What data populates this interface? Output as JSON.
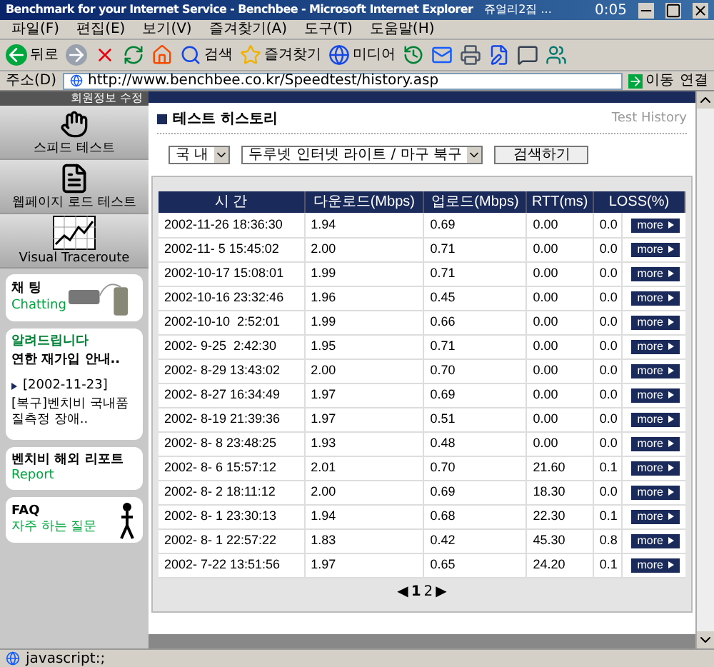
{
  "window": {
    "title": "Benchmark for your Internet Service - Benchbee - Microsoft Internet Explorer",
    "extra": "쥬얼리2집 ...",
    "clock": "0:05"
  },
  "menu": [
    "파일(F)",
    "편집(E)",
    "보기(V)",
    "즐겨찾기(A)",
    "도구(T)",
    "도움말(H)"
  ],
  "toolbar": [
    {
      "kind": "back",
      "label": "뒤로"
    },
    {
      "kind": "forward"
    },
    {
      "kind": "stop"
    },
    {
      "kind": "refresh"
    },
    {
      "kind": "home"
    },
    {
      "kind": "search",
      "label": "검색"
    },
    {
      "kind": "favorites",
      "label": "즐겨찾기"
    },
    {
      "kind": "media",
      "label": "미디어"
    },
    {
      "kind": "history"
    },
    {
      "kind": "mail"
    },
    {
      "kind": "print"
    },
    {
      "kind": "edit"
    },
    {
      "kind": "discuss"
    },
    {
      "kind": "messenger"
    }
  ],
  "address": {
    "label": "주소(D)",
    "value": "http://www.benchbee.co.kr/Speedtest/history.asp",
    "go": "이동",
    "links": "연결"
  },
  "sidebar": {
    "member": "회원정보 수정",
    "nav": [
      {
        "kind": "hand",
        "label": "스피드 테스트"
      },
      {
        "kind": "page",
        "label": "웹페이지 로드 테스트"
      },
      {
        "kind": "graph",
        "label": "Visual Traceroute"
      }
    ],
    "chat": {
      "title": "채 팅",
      "subtitle": "Chatting"
    },
    "notice": {
      "title": "알려드립니다",
      "headline": "연한 재가입 안내..",
      "date": "[2002-11-23]",
      "text": "[복구]벤치비 국내품질측정 장애.."
    },
    "report": {
      "title": "벤치비 해외 리포트",
      "subtitle": "Report"
    },
    "faq": {
      "title": "FAQ",
      "subtitle": "자주 하는 질문"
    }
  },
  "main": {
    "title": "테스트 히스토리",
    "subtitle": "Test History",
    "filters": [
      "국 내",
      "두루넷 인터넷 라이트 / 마구 북구"
    ],
    "search_button": "검색하기",
    "table": {
      "columns": [
        "시 간",
        "다운로드(Mbps)",
        "업로드(Mbps)",
        "RTT(ms)",
        "LOSS(%)"
      ],
      "rows": [
        {
          "cells": [
            "2002-11-26 18:36:30",
            "1.94",
            "0.69",
            "0.00",
            "0.0"
          ],
          "more": "more"
        },
        {
          "cells": [
            "2002-11- 5 15:45:02",
            "2.00",
            "0.71",
            "0.00",
            "0.0"
          ],
          "more": "more"
        },
        {
          "cells": [
            "2002-10-17 15:08:01",
            "1.99",
            "0.71",
            "0.00",
            "0.0"
          ],
          "more": "more"
        },
        {
          "cells": [
            "2002-10-16 23:32:46",
            "1.96",
            "0.45",
            "0.00",
            "0.0"
          ],
          "more": "more"
        },
        {
          "cells": [
            "2002-10-10  2:52:01",
            "1.99",
            "0.66",
            "0.00",
            "0.0"
          ],
          "more": "more"
        },
        {
          "cells": [
            "2002- 9-25  2:42:30",
            "1.95",
            "0.71",
            "0.00",
            "0.0"
          ],
          "more": "more"
        },
        {
          "cells": [
            "2002- 8-29 13:43:02",
            "2.00",
            "0.70",
            "0.00",
            "0.0"
          ],
          "more": "more"
        },
        {
          "cells": [
            "2002- 8-27 16:34:49",
            "1.97",
            "0.69",
            "0.00",
            "0.0"
          ],
          "more": "more"
        },
        {
          "cells": [
            "2002- 8-19 21:39:36",
            "1.97",
            "0.51",
            "0.00",
            "0.0"
          ],
          "more": "more"
        },
        {
          "cells": [
            "2002- 8- 8 23:48:25",
            "1.93",
            "0.48",
            "0.00",
            "0.0"
          ],
          "more": "more"
        },
        {
          "cells": [
            "2002- 8- 6 15:57:12",
            "2.01",
            "0.70",
            "21.60",
            "0.1"
          ],
          "more": "more"
        },
        {
          "cells": [
            "2002- 8- 2 18:11:12",
            "2.00",
            "0.69",
            "18.30",
            "0.0"
          ],
          "more": "more"
        },
        {
          "cells": [
            "2002- 8- 1 23:30:13",
            "1.94",
            "0.68",
            "22.30",
            "0.1"
          ],
          "more": "more"
        },
        {
          "cells": [
            "2002- 8- 1 22:57:22",
            "1.83",
            "0.42",
            "45.30",
            "0.8"
          ],
          "more": "more"
        },
        {
          "cells": [
            "2002- 7-22 13:51:56",
            "1.97",
            "0.65",
            "24.20",
            "0.1"
          ],
          "more": "more"
        }
      ]
    },
    "pagination": [
      {
        "label": "◀",
        "kind": "arrow"
      },
      {
        "label": "1",
        "kind": "page",
        "selected": true
      },
      {
        "label": "2",
        "kind": "page",
        "selected": false
      },
      {
        "label": "▶",
        "kind": "arrow"
      }
    ]
  },
  "status": {
    "text": "javascript:;"
  }
}
